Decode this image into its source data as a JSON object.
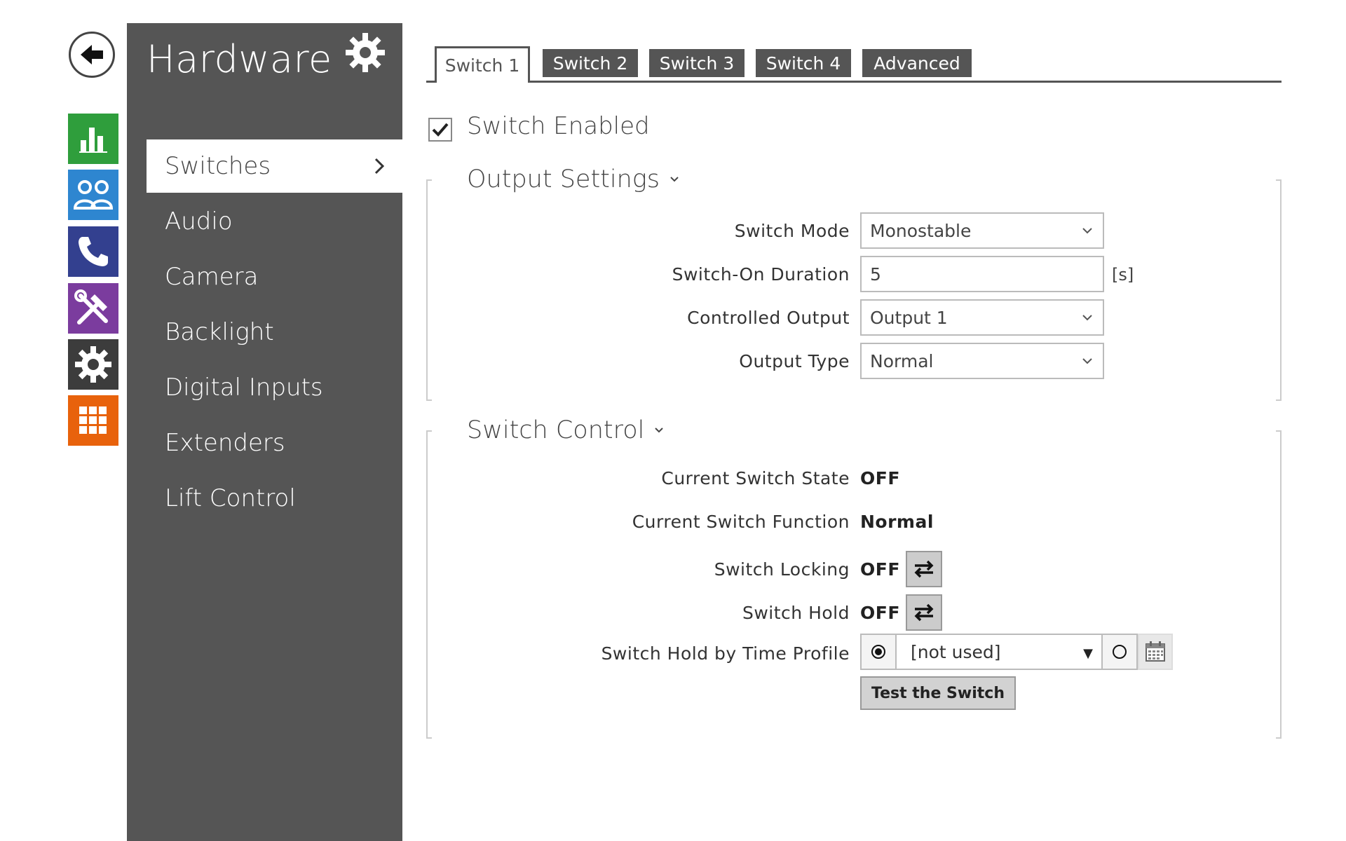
{
  "sidebar": {
    "title": "Hardware",
    "items": [
      {
        "label": "Switches",
        "active": true
      },
      {
        "label": "Audio"
      },
      {
        "label": "Camera"
      },
      {
        "label": "Backlight"
      },
      {
        "label": "Digital Inputs"
      },
      {
        "label": "Extenders"
      },
      {
        "label": "Lift Control"
      }
    ]
  },
  "rail": {
    "tiles": [
      {
        "icon": "status-chart-icon",
        "color": "#2f9e3c"
      },
      {
        "icon": "directory-users-icon",
        "color": "#2e86d0"
      },
      {
        "icon": "phone-icon",
        "color": "#33408f"
      },
      {
        "icon": "tools-icon",
        "color": "#7b3c9e"
      },
      {
        "icon": "settings-gear-icon",
        "color": "#3c3c3c"
      },
      {
        "icon": "apps-grid-icon",
        "color": "#e8620c"
      }
    ]
  },
  "tabs": [
    {
      "label": "Switch 1",
      "active": true
    },
    {
      "label": "Switch 2"
    },
    {
      "label": "Switch 3"
    },
    {
      "label": "Switch 4"
    },
    {
      "label": "Advanced"
    }
  ],
  "switch_enabled": {
    "label": "Switch Enabled",
    "checked": true
  },
  "output_settings": {
    "title": "Output Settings",
    "switch_mode": {
      "label": "Switch Mode",
      "value": "Monostable"
    },
    "on_duration": {
      "label": "Switch-On Duration",
      "value": "5",
      "unit": "[s]"
    },
    "controlled_output": {
      "label": "Controlled Output",
      "value": "Output 1"
    },
    "output_type": {
      "label": "Output Type",
      "value": "Normal"
    }
  },
  "switch_control": {
    "title": "Switch Control",
    "state": {
      "label": "Current Switch State",
      "value": "OFF"
    },
    "function": {
      "label": "Current Switch Function",
      "value": "Normal"
    },
    "locking": {
      "label": "Switch Locking",
      "value": "OFF"
    },
    "hold": {
      "label": "Switch Hold",
      "value": "OFF"
    },
    "time_profile": {
      "label": "Switch Hold by Time Profile",
      "value": "[not used]"
    },
    "test_label": "Test the Switch"
  }
}
